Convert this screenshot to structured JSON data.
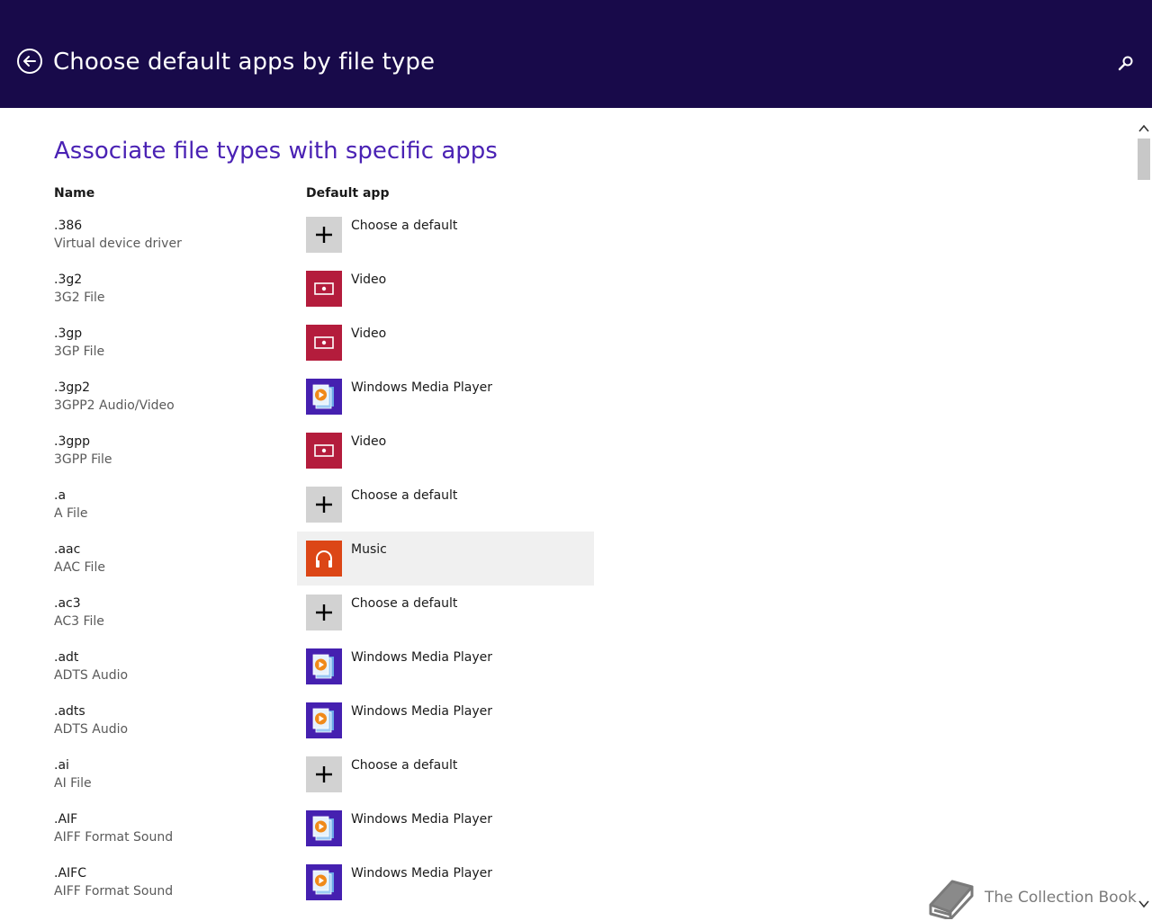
{
  "header": {
    "title": "Choose default apps by file type",
    "background": "#180a4a"
  },
  "main": {
    "heading": "Associate file types with specific apps",
    "heading_color": "#4a22b4",
    "columns": {
      "name": "Name",
      "default_app": "Default app"
    },
    "rows": [
      {
        "ext": ".386",
        "desc": "Virtual device driver",
        "app": "Choose a default",
        "icon": "plus-icon"
      },
      {
        "ext": ".3g2",
        "desc": "3G2 File",
        "app": "Video",
        "icon": "video-icon"
      },
      {
        "ext": ".3gp",
        "desc": "3GP File",
        "app": "Video",
        "icon": "video-icon"
      },
      {
        "ext": ".3gp2",
        "desc": "3GPP2 Audio/Video",
        "app": "Windows Media Player",
        "icon": "windows-media-player-icon"
      },
      {
        "ext": ".3gpp",
        "desc": "3GPP File",
        "app": "Video",
        "icon": "video-icon"
      },
      {
        "ext": ".a",
        "desc": "A File",
        "app": "Choose a default",
        "icon": "plus-icon"
      },
      {
        "ext": ".aac",
        "desc": "AAC File",
        "app": "Music",
        "icon": "music-icon"
      },
      {
        "ext": ".ac3",
        "desc": "AC3 File",
        "app": "Choose a default",
        "icon": "plus-icon"
      },
      {
        "ext": ".adt",
        "desc": "ADTS Audio",
        "app": "Windows Media Player",
        "icon": "windows-media-player-icon"
      },
      {
        "ext": ".adts",
        "desc": "ADTS Audio",
        "app": "Windows Media Player",
        "icon": "windows-media-player-icon"
      },
      {
        "ext": ".ai",
        "desc": "AI File",
        "app": "Choose a default",
        "icon": "plus-icon"
      },
      {
        "ext": ".AIF",
        "desc": "AIFF Format Sound",
        "app": "Windows Media Player",
        "icon": "windows-media-player-icon"
      },
      {
        "ext": ".AIFC",
        "desc": "AIFF Format Sound",
        "app": "Windows Media Player",
        "icon": "windows-media-player-icon"
      }
    ]
  },
  "watermark": {
    "text": "The Collection Book"
  },
  "colors": {
    "video": "#b41c3c",
    "windows_media_player": "#4520b0",
    "music": "#dc4616",
    "choose_default": "#d2d2d2",
    "hover_row": "#f0f0f0"
  }
}
